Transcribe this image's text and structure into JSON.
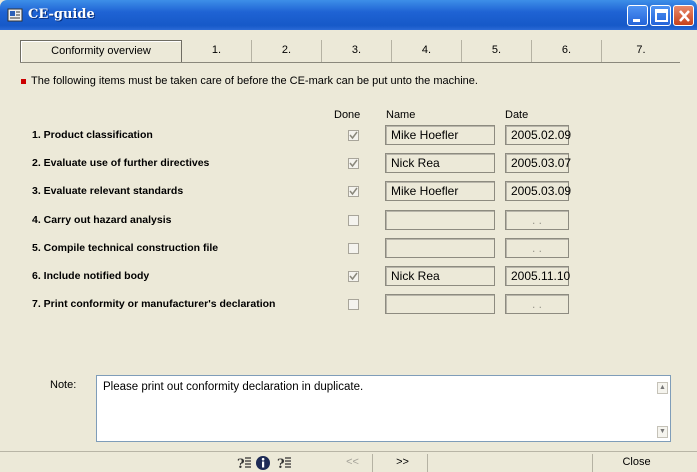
{
  "window": {
    "title": "CE-guide"
  },
  "tabs": [
    {
      "label": "Conformity overview",
      "active": true
    },
    {
      "label": "1."
    },
    {
      "label": "2."
    },
    {
      "label": "3."
    },
    {
      "label": "4."
    },
    {
      "label": "5."
    },
    {
      "label": "6."
    },
    {
      "label": "7."
    }
  ],
  "intro_text": "The following items must be taken care of before the CE-mark can be put unto the machine.",
  "columns": {
    "done": "Done",
    "name": "Name",
    "date": "Date"
  },
  "items": [
    {
      "label": "1. Product classification",
      "done": true,
      "name": "Mike Hoefler",
      "date": "2005.02.09"
    },
    {
      "label": "2. Evaluate use of further directives",
      "done": true,
      "name": "Nick Rea",
      "date": "2005.03.07"
    },
    {
      "label": "3. Evaluate relevant standards",
      "done": true,
      "name": "Mike Hoefler",
      "date": "2005.03.09"
    },
    {
      "label": "4. Carry out hazard analysis",
      "done": false,
      "name": "",
      "date": ". ."
    },
    {
      "label": "5. Compile technical construction file",
      "done": false,
      "name": "",
      "date": ". ."
    },
    {
      "label": "6. Include notified body",
      "done": true,
      "name": "Nick Rea",
      "date": "2005.11.10"
    },
    {
      "label": "7. Print conformity or manufacturer's declaration",
      "done": false,
      "name": "",
      "date": ". ."
    }
  ],
  "note": {
    "label": "Note:",
    "text": "Please print out conformity declaration in duplicate."
  },
  "footer": {
    "prev": "<<",
    "next": ">>",
    "close": "Close",
    "icons": [
      "help-tool-icon",
      "info-icon",
      "help-tool-icon"
    ]
  },
  "colors": {
    "titlebar": "#1f63d4",
    "bullet": "#cc0000",
    "window_bg": "#ece9d8"
  }
}
